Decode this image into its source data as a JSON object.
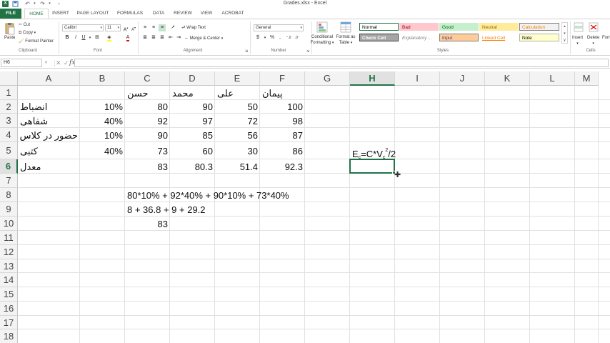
{
  "window": {
    "title": "Grades.xlsx - Excel"
  },
  "tabs": [
    "FILE",
    "HOME",
    "INSERT",
    "PAGE LAYOUT",
    "FORMULAS",
    "DATA",
    "REVIEW",
    "VIEW",
    "ACROBAT"
  ],
  "ribbon": {
    "clipboard": {
      "label": "Clipboard",
      "paste": "Paste",
      "cut": "Cut",
      "copy": "Copy",
      "format_painter": "Format Painter"
    },
    "font": {
      "label": "Font",
      "name": "Calibri",
      "size": "11"
    },
    "alignment": {
      "label": "Alignment",
      "wrap_text": "Wrap Text",
      "merge_center": "Merge & Center"
    },
    "number": {
      "label": "Number",
      "format": "General"
    },
    "styles": {
      "label": "Styles",
      "conditional": "Conditional",
      "formatting": "Formatting",
      "format_as": "Format as",
      "table": "Table",
      "cells": [
        {
          "name": "Normal",
          "bg": "#ffffff",
          "fg": "#000000",
          "border": "#217346"
        },
        {
          "name": "Bad",
          "bg": "#ffc7ce",
          "fg": "#9c0006",
          "border": "#ffc7ce"
        },
        {
          "name": "Good",
          "bg": "#c6efce",
          "fg": "#006100",
          "border": "#c6efce"
        },
        {
          "name": "Neutral",
          "bg": "#ffeb9c",
          "fg": "#9c6500",
          "border": "#ffeb9c"
        },
        {
          "name": "Calculation",
          "bg": "#f2f2f2",
          "fg": "#fa7d00",
          "border": "#7f7f7f"
        },
        {
          "name": "Check Cell",
          "bg": "#a5a5a5",
          "fg": "#ffffff",
          "border": "#3f3f3f"
        },
        {
          "name": "Explanatory ...",
          "bg": "#ffffff",
          "fg": "#7f7f7f",
          "border": "#ffffff"
        },
        {
          "name": "Input",
          "bg": "#ffcc99",
          "fg": "#3f3f76",
          "border": "#7f7f7f"
        },
        {
          "name": "Linked Cell",
          "bg": "#ffffff",
          "fg": "#fa7d00",
          "border": "#ffffff"
        },
        {
          "name": "Note",
          "bg": "#ffffcc",
          "fg": "#000000",
          "border": "#b2b2b2"
        }
      ]
    },
    "cells_group": {
      "label": "Cells",
      "insert": "Insert",
      "delete": "Delete",
      "format": "Form"
    }
  },
  "formula_bar": {
    "name_box": "H6",
    "fx": "fx",
    "content": ""
  },
  "columns": [
    "A",
    "B",
    "C",
    "D",
    "E",
    "F",
    "G",
    "H",
    "I",
    "J",
    "K",
    "L",
    "M"
  ],
  "selected_column": "H",
  "rows": [
    "1",
    "2",
    "3",
    "4",
    "5",
    "6",
    "7",
    "8",
    "9",
    "10",
    "11",
    "12",
    "13",
    "14",
    "15",
    "16",
    "17",
    "18"
  ],
  "selected_row": "6",
  "cells": {
    "C1": "حسن",
    "D1": "محمد",
    "E1": "علی",
    "F1": "پیمان",
    "A2": "انضباط",
    "B2": "10%",
    "C2": "80",
    "D2": "90",
    "E2": "50",
    "F2": "100",
    "A3": "شفاهی",
    "B3": "40%",
    "C3": "92",
    "D3": "97",
    "E3": "72",
    "F3": "98",
    "A4": "حضور در کلاس",
    "B4": "10%",
    "C4": "90",
    "D4": "85",
    "E4": "56",
    "F4": "87",
    "A5": "کتبی",
    "B5": "40%",
    "C5": "73",
    "D5": "60",
    "E5": "30",
    "F5": "86",
    "A6": "معدل",
    "C6": "83",
    "D6": "80.3",
    "E6": "51.4",
    "F6": "92.3",
    "C8": "80*10% + 92*40% + 90*10% + 73*40%",
    "C9": "8 + 36.8 + 9 + 29.2",
    "C10": "83"
  },
  "h5_formula": {
    "E": "E",
    "c1": "c",
    "eq": "=C*V",
    "c2": "c",
    "pow": "2",
    "tail": "/2"
  },
  "accent_color": "#217346"
}
